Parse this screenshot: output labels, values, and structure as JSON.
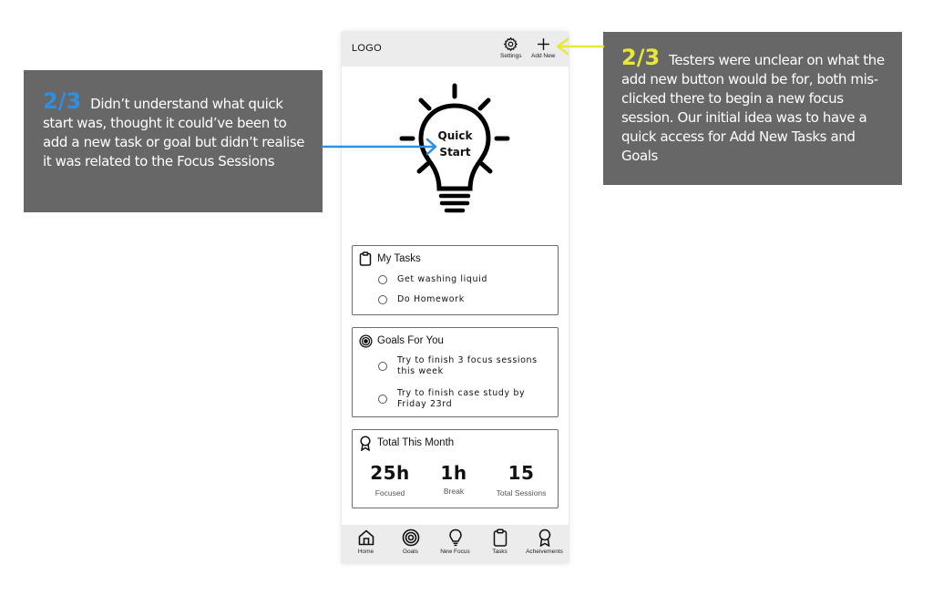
{
  "app": {
    "logo": "LOGO",
    "header_actions": [
      {
        "label": "Settings",
        "icon": "gear-icon"
      },
      {
        "label": "Add New",
        "icon": "plus-icon"
      }
    ],
    "quick_start": {
      "line1": "Quick",
      "line2": "Start",
      "icon": "lightbulb-icon"
    },
    "my_tasks": {
      "title": "My Tasks",
      "icon": "clipboard-icon",
      "items": [
        "Get washing liquid",
        "Do Homework"
      ]
    },
    "goals": {
      "title": "Goals For You",
      "icon": "target-icon",
      "items": [
        {
          "line1": "Try to finish 3 focus sessions",
          "line2": "this week"
        },
        {
          "line1": "Try to finish case study by",
          "line2": "Friday 23rd"
        }
      ]
    },
    "totals": {
      "title": "Total This Month",
      "icon": "award-ribbon-icon",
      "stats": [
        {
          "value": "25h",
          "label": "Focused"
        },
        {
          "value": "1h",
          "label": "Break"
        },
        {
          "value": "15",
          "label": "Total Sessions"
        }
      ]
    },
    "bottom_nav": [
      {
        "label": "Home",
        "icon": "home-icon"
      },
      {
        "label": "Goals",
        "icon": "target-icon"
      },
      {
        "label": "New Focus",
        "icon": "lightbulb-icon"
      },
      {
        "label": "Tasks",
        "icon": "clipboard-icon"
      },
      {
        "label": "Acheivements",
        "icon": "award-ribbon-icon"
      }
    ]
  },
  "annotations": {
    "left": {
      "count": "2/3",
      "text": "Didn’t understand what quick start was, thought it could’ve been to add a new task or goal but didn’t realise it was related to the Focus Sessions",
      "color": "#2f8fe0"
    },
    "right": {
      "count": "2/3",
      "text": "Testers were unclear on what the add new button would be for, both mis-clicked there to begin a new focus session. Our initial idea was to have a quick access for Add New Tasks and Goals",
      "color": "#e6e83a"
    }
  }
}
